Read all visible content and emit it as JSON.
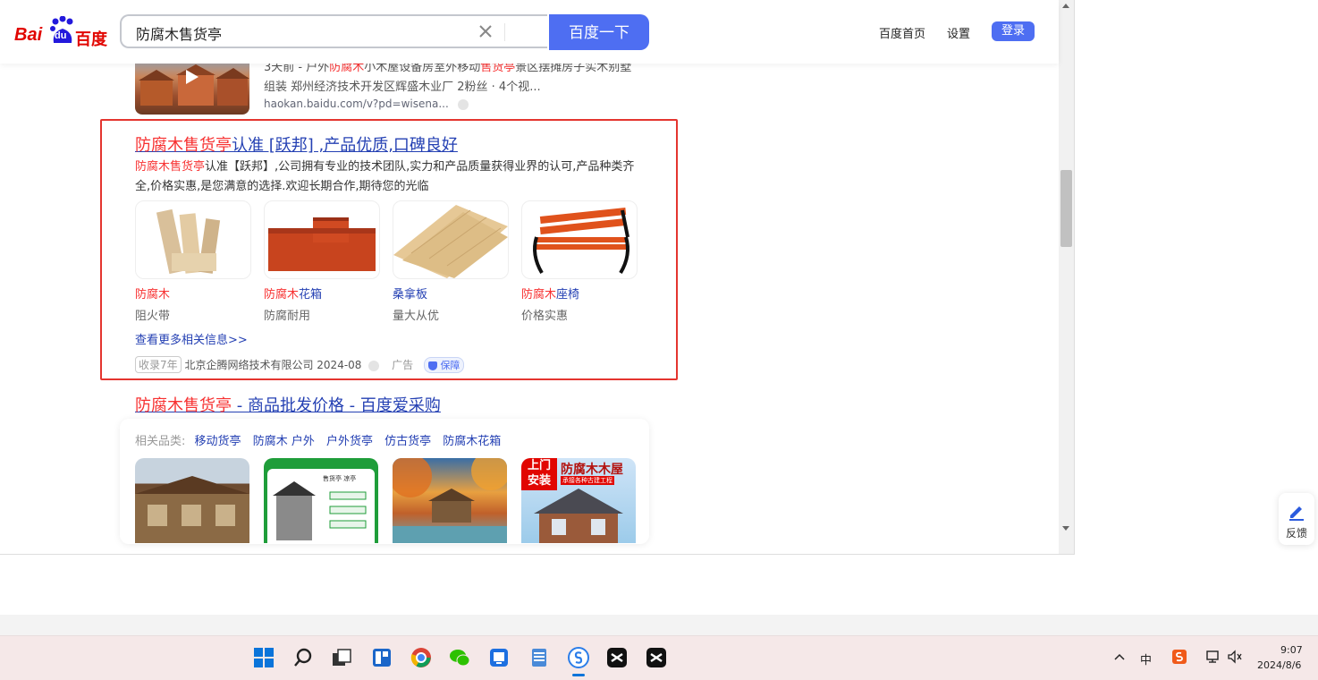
{
  "header": {
    "logo_bai": "Bai",
    "logo_du": "du",
    "logo_cn": "百度",
    "search_value": "防腐木售货亭",
    "search_button": "百度一下",
    "nav_home": "百度首页",
    "nav_settings": "设置",
    "login": "登录"
  },
  "video_result": {
    "line1_prefix": "3天前 - 户外",
    "line1_em": "防腐木",
    "line1_mid": "小木屋设备房室外移动",
    "line1_em2": "售货亭",
    "line1_suffix": "景区摆摊房子实木别墅",
    "line2": "组装 郑州经济技术开发区辉盛木业厂 2粉丝 · 4个视...",
    "url": "haokan.baidu.com/v?pd=wisena..."
  },
  "ad_result": {
    "title_em": "防腐木售货亭",
    "title_rest": "认准 [跃邦] ,产品优质,口碑良好",
    "desc_em": "防腐木售货亭",
    "desc_rest": "认准【跃邦】,公司拥有专业的技术团队,实力和产品质量获得业界的认可,产品种类齐全,价格实惠,是您满意的选择.欢迎长期合作,期待您的光临",
    "cards": [
      {
        "em": "防腐木",
        "rest": "",
        "sub": "阻火带"
      },
      {
        "em": "防腐木",
        "rest": "花箱",
        "sub": "防腐耐用"
      },
      {
        "em": "",
        "rest": "桑拿板",
        "sub": "量大从优"
      },
      {
        "em": "防腐木",
        "rest": "座椅",
        "sub": "价格实惠"
      }
    ],
    "more_link": "查看更多相关信息>>",
    "badge_years": "收录7年",
    "company": "北京企腾网络技术有限公司 2024-08",
    "ad_label": "广告",
    "guarantee": "保障"
  },
  "third_result": {
    "title_em": "防腐木售货亭",
    "title_rest": " - 商品批发价格 - 百度爱采购",
    "related_label": "相关品类:",
    "related_links": [
      "移动货亭",
      "防腐木 户外",
      "户外货亭",
      "仿古货亭",
      "防腐木花箱"
    ],
    "poster_text": "售货亭 凉亭",
    "ad_banner_top": "上门",
    "ad_banner_bottom": "安装",
    "ad_banner_title": "防腐木木屋",
    "ad_banner_sub": "承接各种古建工程"
  },
  "feedback": "反馈",
  "tray": {
    "ime": "中",
    "time": "9:07",
    "date": "2024/8/6"
  }
}
